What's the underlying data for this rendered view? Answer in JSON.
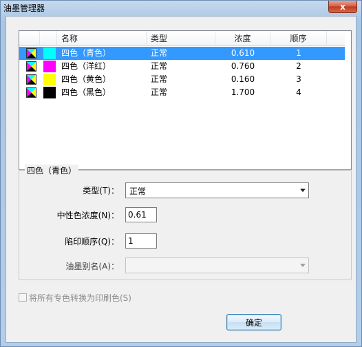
{
  "window": {
    "title": "油墨管理器",
    "close_label": "x"
  },
  "list": {
    "headers": {
      "name": "名称",
      "type": "类型",
      "density": "浓度",
      "order": "顺序"
    },
    "rows": [
      {
        "name": "四色（青色）",
        "type": "正常",
        "density": "0.610",
        "order": "1",
        "color": "#00ffff",
        "selected": true
      },
      {
        "name": "四色（洋红）",
        "type": "正常",
        "density": "0.760",
        "order": "2",
        "color": "#ff00ff",
        "selected": false
      },
      {
        "name": "四色（黄色）",
        "type": "正常",
        "density": "0.160",
        "order": "3",
        "color": "#ffff00",
        "selected": false
      },
      {
        "name": "四色（黑色）",
        "type": "正常",
        "density": "1.700",
        "order": "4",
        "color": "#000000",
        "selected": false
      }
    ]
  },
  "details": {
    "group_title": "四色（青色）",
    "type_label": "类型(T)：",
    "type_value": "正常",
    "density_label": "中性色浓度(N)：",
    "density_value": "0.61",
    "trap_label": "陷印顺序(Q)：",
    "trap_value": "1",
    "alias_label": "油墨别名(A)：",
    "alias_value": ""
  },
  "convert_spot": {
    "label": "将所有专色转换为印刷色(S)",
    "checked": false
  },
  "ok_label": "确定",
  "colors": {
    "selection": "#3399ff",
    "cyan": "#00ffff",
    "magenta": "#ff00ff",
    "yellow": "#ffff00",
    "black": "#000000"
  }
}
